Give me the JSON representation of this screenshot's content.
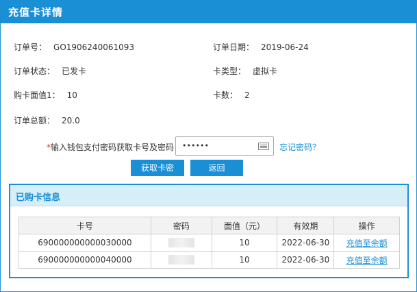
{
  "header": {
    "title": "充值卡详情"
  },
  "order": {
    "order_no": {
      "label": "订单号：",
      "value": "GO1906240061093"
    },
    "order_date": {
      "label": "订单日期：",
      "value": "2019-06-24"
    },
    "order_status": {
      "label": "订单状态：",
      "value": "已发卡"
    },
    "card_type": {
      "label": "卡类型：",
      "value": "虚拟卡"
    },
    "face_value": {
      "label": "购卡面值1：",
      "value": "10"
    },
    "card_count": {
      "label": "卡数：",
      "value": "2"
    },
    "total": {
      "label": "订单总额：",
      "value": "20.0"
    }
  },
  "password": {
    "required_mark": "*",
    "label": "输入钱包支付密码获取卡号及密码：",
    "value": "••••••",
    "forgot_link": "忘记密码？"
  },
  "buttons": {
    "get_card": "获取卡密",
    "back": "返回"
  },
  "cards_panel": {
    "title": "已购卡信息",
    "columns": [
      "卡号",
      "密码",
      "面值（元）",
      "有效期",
      "操作"
    ],
    "rows": [
      {
        "card_no": "690000000000030000",
        "face": "10",
        "expiry": "2022-06-30",
        "action": "充值至余额"
      },
      {
        "card_no": "690000000000040000",
        "face": "10",
        "expiry": "2022-06-30",
        "action": "充值至余额"
      }
    ]
  },
  "colors": {
    "primary": "#1a8fd6",
    "panel_header_bg": "#d6eef8",
    "required": "#e0322d"
  }
}
